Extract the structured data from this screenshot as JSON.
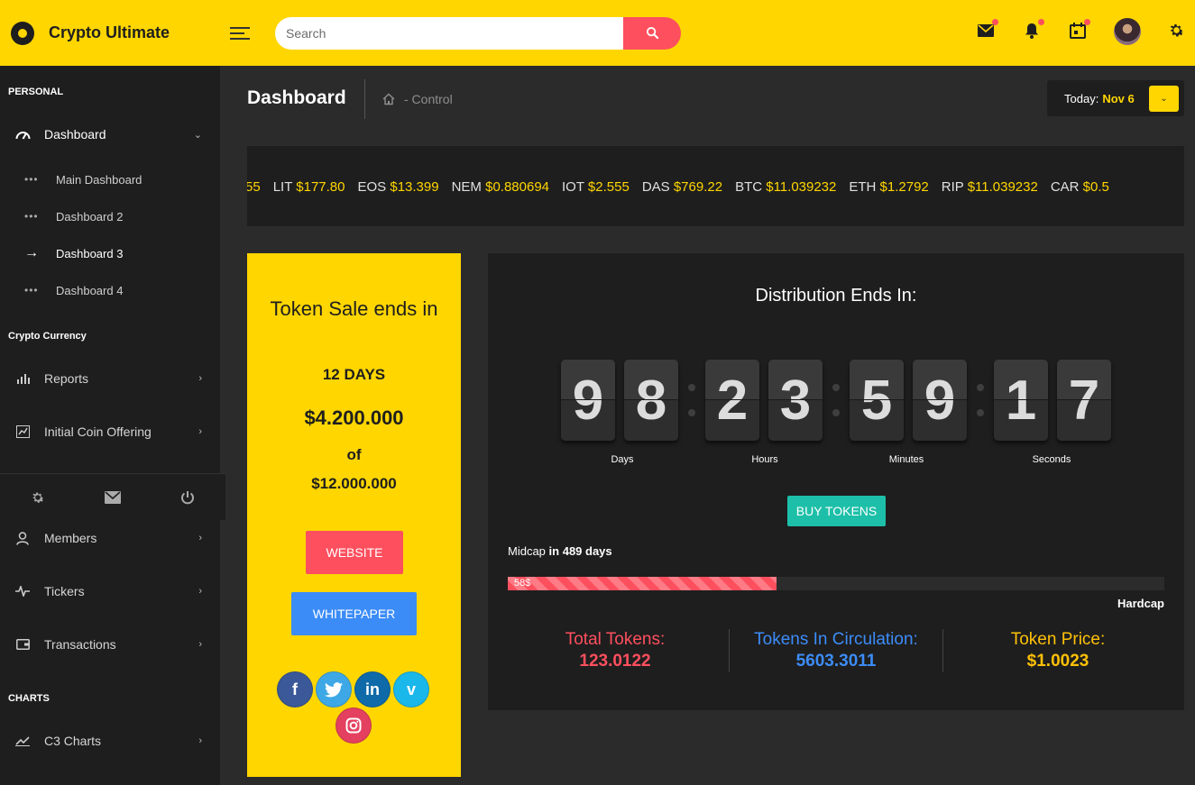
{
  "app": {
    "name": "Crypto Ultimate"
  },
  "search": {
    "placeholder": "Search"
  },
  "sidebar": {
    "section_personal": "PERSONAL",
    "dashboard_label": "Dashboard",
    "submenu": [
      "Main Dashboard",
      "Dashboard 2",
      "Dashboard 3",
      "Dashboard 4"
    ],
    "section_crypto": "Crypto Currency",
    "reports_label": "Reports",
    "ico_label": "Initial Coin Offering",
    "members_label": "Members",
    "tickers_label": "Tickers",
    "transactions_label": "Transactions",
    "section_charts": "CHARTS",
    "c3_label": "C3 Charts"
  },
  "header": {
    "page_title": "Dashboard",
    "breadcrumb": "- Control",
    "date_label": "Today:",
    "date_value": "Nov 6"
  },
  "ticker": {
    "lead_fragment": "55",
    "items": [
      {
        "sym": "LIT",
        "price": "$177.80"
      },
      {
        "sym": "EOS",
        "price": "$13.399"
      },
      {
        "sym": "NEM",
        "price": "$0.880694"
      },
      {
        "sym": "IOT",
        "price": "$2.555"
      },
      {
        "sym": "DAS",
        "price": "$769.22"
      },
      {
        "sym": "BTC",
        "price": "$11.039232"
      },
      {
        "sym": "ETH",
        "price": "$1.2792"
      },
      {
        "sym": "RIP",
        "price": "$11.039232"
      },
      {
        "sym": "CAR",
        "price": "$0.5"
      }
    ]
  },
  "token_sale": {
    "heading": "Token Sale ends in",
    "days": "12 DAYS",
    "amount": "$4.200.000",
    "of": "of",
    "total": "$12.000.000",
    "website_btn": "WEBSITE",
    "whitepaper_btn": "WHITEPAPER"
  },
  "distribution": {
    "title": "Distribution Ends In:",
    "digits": [
      "9",
      "8",
      "2",
      "3",
      "5",
      "9",
      "1",
      "7"
    ],
    "units": [
      "Days",
      "Hours",
      "Minutes",
      "Seconds"
    ],
    "buy_btn": "BUY TOKENS",
    "midcap_prefix": "Midcap",
    "midcap_suffix": "in 489 days",
    "progress_label": "58$",
    "progress_percent": 41,
    "hardcap": "Hardcap",
    "stats": [
      {
        "label": "Total Tokens:",
        "value": "123.0122",
        "color": "#fe4f5e"
      },
      {
        "label": "Tokens In Circulation:",
        "value": "5603.3011",
        "color": "#3c8cf7"
      },
      {
        "label": "Token Price:",
        "value": "$1.0023",
        "color": "#ffc107"
      }
    ]
  },
  "colors": {
    "accent": "#ffd600",
    "danger": "#fe4f5e",
    "primary": "#3c8cf7",
    "success": "#1dbfa8",
    "dark": "#1e1e1e"
  }
}
